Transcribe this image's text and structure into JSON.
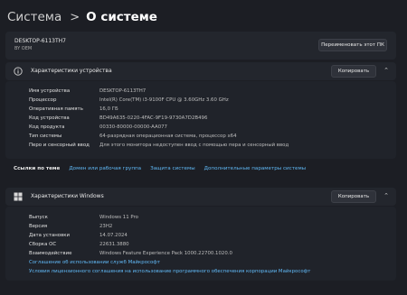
{
  "breadcrumb": {
    "parent": "Система",
    "separator": ">",
    "current": "О системе"
  },
  "device": {
    "name": "DESKTOP-6113TH7",
    "model": "BY OEM",
    "rename_label": "Переименовать этот ПК"
  },
  "device_specs": {
    "title": "Характеристики устройства",
    "copy_label": "Копировать",
    "rows": [
      {
        "label": "Имя устройства",
        "value": "DESKTOP-6113TH7"
      },
      {
        "label": "Процессор",
        "value": "Intel(R) Core(TM) i3-9100F CPU @ 3.60GHz   3.60 GHz"
      },
      {
        "label": "Оперативная память",
        "value": "16,0 ГБ"
      },
      {
        "label": "Код устройства",
        "value": "BD49A635-0220-4FAC-9F19-9730A7D2B496"
      },
      {
        "label": "Код продукта",
        "value": "00330-80000-00000-AA077"
      },
      {
        "label": "Тип системы",
        "value": "64-разрядная операционная система, процессор x64"
      },
      {
        "label": "Перо и сенсорный ввод",
        "value": "Для этого монитора недоступен ввод с помощью пера и сенсорный ввод"
      }
    ]
  },
  "related_links": {
    "title": "Ссылки по теме",
    "items": [
      "Домен или рабочая группа",
      "Защита системы",
      "Дополнительные параметры системы"
    ]
  },
  "windows_specs": {
    "title": "Характеристики Windows",
    "copy_label": "Копировать",
    "rows": [
      {
        "label": "Выпуск",
        "value": "Windows 11 Pro"
      },
      {
        "label": "Версия",
        "value": "23H2"
      },
      {
        "label": "Дата установки",
        "value": "14.07.2024"
      },
      {
        "label": "Сборка ОС",
        "value": "22631.3880"
      },
      {
        "label": "Взаимодействие",
        "value": "Windows Feature Experience Pack 1000.22700.1020.0"
      }
    ],
    "links": [
      "Соглашение об использовании служб Майкрософт",
      "Условия лицензионного соглашения на использование программного обеспечения корпорации Майкрософт"
    ]
  },
  "icons": {
    "device_section": "info-icon",
    "windows_section": "windows-logo-icon",
    "collapse": "chevron-up-icon"
  },
  "colors": {
    "background": "#1c1e24",
    "card": "#23262d",
    "link": "#60b8f5"
  }
}
